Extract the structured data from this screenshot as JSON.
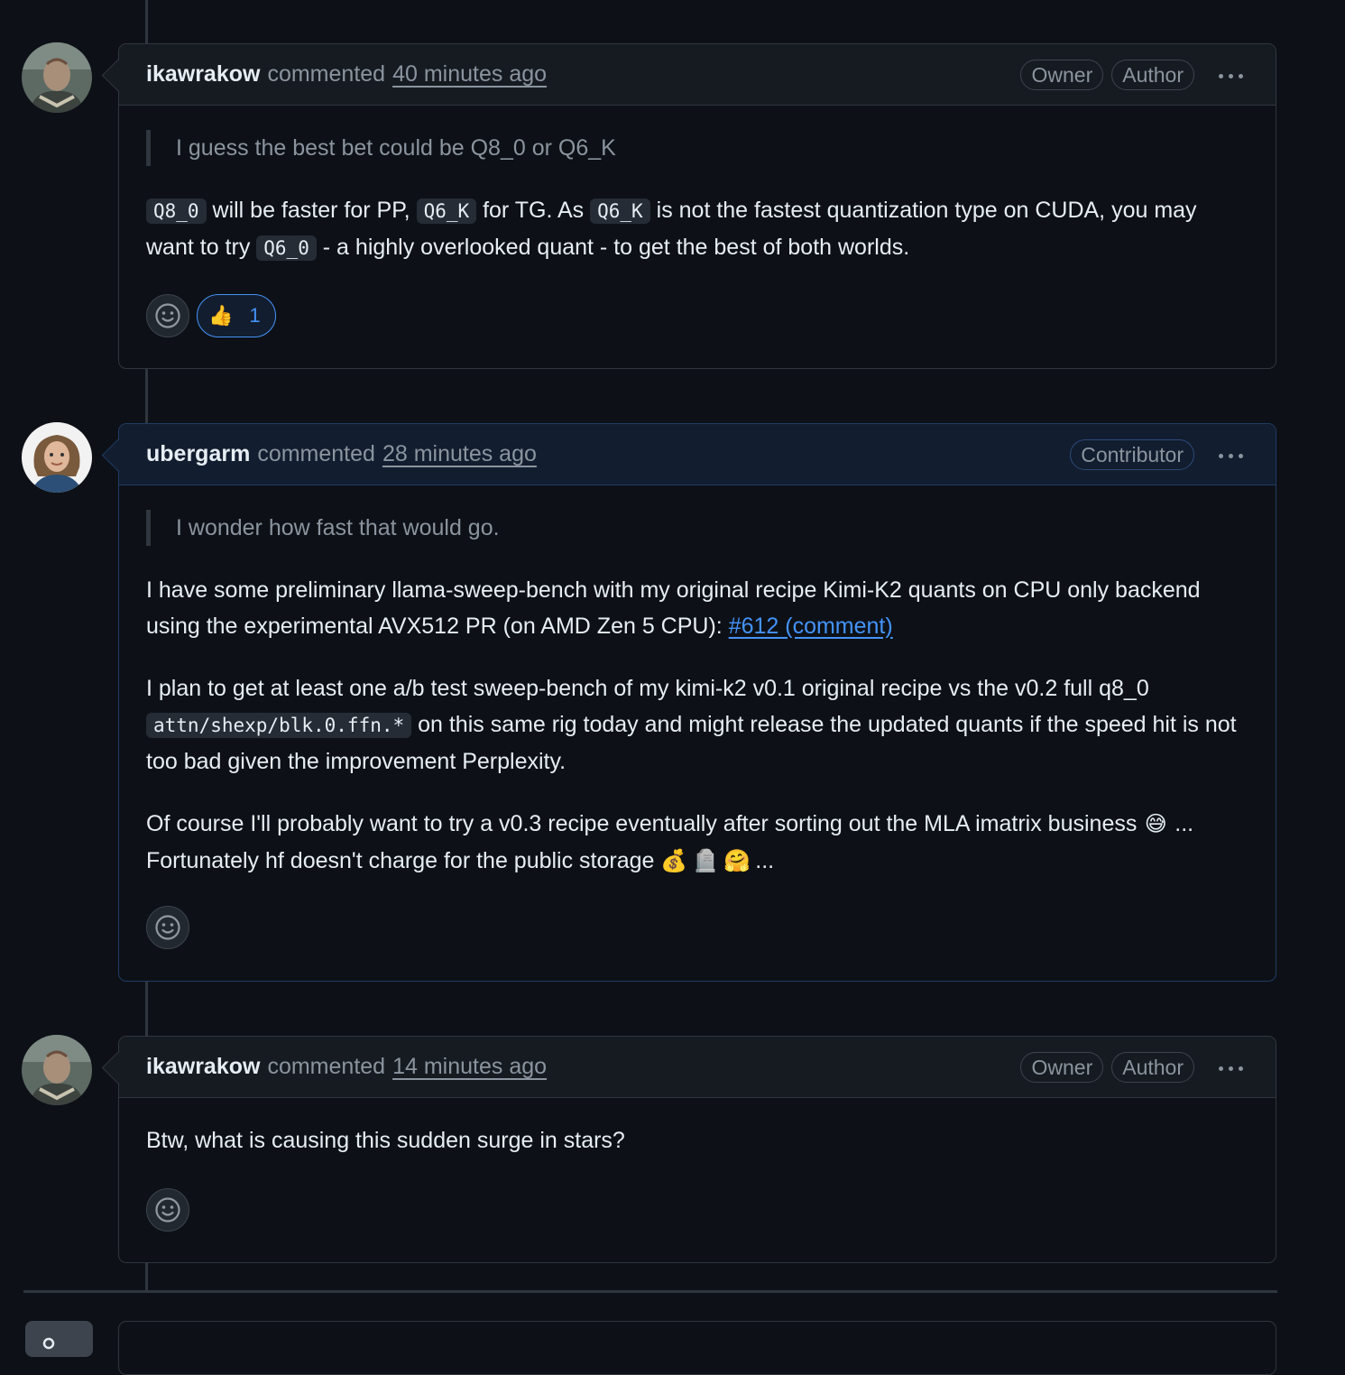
{
  "comments": [
    {
      "author": "ikawrakow",
      "verb": "commented",
      "time": "40 minutes ago",
      "badges": [
        "Owner",
        "Author"
      ],
      "quote": "I guess the best bet could be Q8_0 or Q6_K",
      "body": {
        "code1": "Q8_0",
        "t1": " will be faster for PP, ",
        "code2": "Q6_K",
        "t2": " for TG. As ",
        "code3": "Q6_K",
        "t3": " is not the fastest quantization type on CUDA, you may want to try ",
        "code4": "Q6_0",
        "t4": " - a highly overlooked quant - to get the best of both worlds."
      },
      "reaction": {
        "emoji": "👍",
        "count": "1"
      }
    },
    {
      "author": "ubergarm",
      "verb": "commented",
      "time": "28 minutes ago",
      "badges": [
        "Contributor"
      ],
      "quote": "I wonder how fast that would go.",
      "p1_text": "I have some preliminary llama-sweep-bench with my original recipe Kimi-K2 quants on CPU only backend using the experimental AVX512 PR (on AMD Zen 5 CPU): ",
      "p1_link": "#612 (comment)",
      "p2_a": "I plan to get at least one a/b test sweep-bench of my kimi-k2 v0.1 original recipe vs the v0.2 full q8_0 ",
      "p2_code": "attn/shexp/blk.0.ffn.*",
      "p2_b": " on this same rig today and might release the updated quants if the speed hit is not too bad given the improvement Perplexity.",
      "p3_a": "Of course I'll probably want to try a v0.3 recipe eventually after sorting out the MLA imatrix business ",
      "p3_emoji1": "😅",
      "p3_b": " ... Fortunately hf doesn't charge for the public storage ",
      "p3_emoji2": "💰",
      "p3_emoji3": "🪦",
      "p3_emoji4": "🤗",
      "p3_c": " ..."
    },
    {
      "author": "ikawrakow",
      "verb": "commented",
      "time": "14 minutes ago",
      "badges": [
        "Owner",
        "Author"
      ],
      "body": "Btw, what is causing this sudden surge in stars?"
    }
  ],
  "icons": {
    "add_reaction": "smiley-icon",
    "more": "kebab-horizontal-icon"
  },
  "colors": {
    "background": "#0d1117",
    "header": "#161b22",
    "link": "#4493f8",
    "border": "#30363d"
  }
}
